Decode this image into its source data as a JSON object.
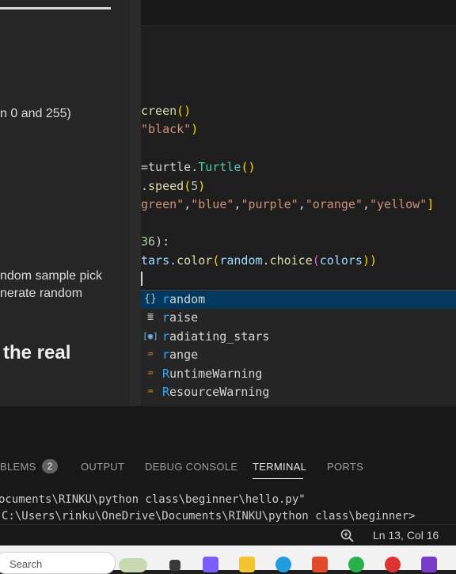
{
  "left_panel": {
    "lines": [
      {
        "id": "l1",
        "text": "n 0 and 255)"
      },
      {
        "id": "l2",
        "text": "ndom sample pick"
      },
      {
        "id": "l3",
        "text": "nerate random"
      }
    ],
    "heading": "the real"
  },
  "editor": {
    "line1": {
      "a": "creen",
      "b": "()"
    },
    "line2": {
      "a": "\"black\"",
      "b": ")"
    },
    "line3": {
      "a": "=turtle.",
      "b": "Turtle",
      "c": "()"
    },
    "line4": {
      "a": ".",
      "b": "speed",
      "c": "(",
      "d": "5",
      "e": ")"
    },
    "line5": {
      "a": "green\"",
      "b": ",",
      "c": "\"blue\"",
      "d": ",",
      "e": "\"purple\"",
      "f": ",",
      "g": "\"orange\"",
      "h": ",",
      "i": "\"yellow\"",
      "j": "]"
    },
    "line6": {
      "a": "36",
      "b": "):"
    },
    "line7": {
      "a": "tars.",
      "b": "color",
      "c": "(",
      "d": "random",
      "e": ".",
      "f": "choice",
      "g": "(",
      "h": "colors",
      "i": "))"
    }
  },
  "suggestions": [
    {
      "icon": "{}",
      "match": "r",
      "rest": "andom"
    },
    {
      "icon": "≣",
      "match": "r",
      "rest": "aise"
    },
    {
      "icon": "[◉]",
      "match": "r",
      "rest": "adiating_stars"
    },
    {
      "icon": "♒",
      "match": "r",
      "rest": "ange"
    },
    {
      "icon": "♒",
      "match": "R",
      "rest": "untimeWarning"
    },
    {
      "icon": "♒",
      "match": "R",
      "rest": "esourceWarning"
    }
  ],
  "panel": {
    "tabs": {
      "problems": "BLEMS",
      "output": "OUTPUT",
      "debug": "DEBUG CONSOLE",
      "terminal": "TERMINAL",
      "ports": "PORTS"
    },
    "problems_count": "2",
    "terminal_lines": [
      "ocuments\\RINKU\\python class\\beginner\\hello.py\"",
      "C:\\Users\\rinku\\OneDrive\\Documents\\RINKU\\python class\\beginner>"
    ]
  },
  "status": {
    "position": "Ln 13, Col 16"
  },
  "taskbar": {
    "search_placeholder": "Search"
  },
  "colors": {
    "accent_selection": "#04395e",
    "match_highlight": "#2aaaff",
    "editor_bg": "#1e1e1e"
  }
}
